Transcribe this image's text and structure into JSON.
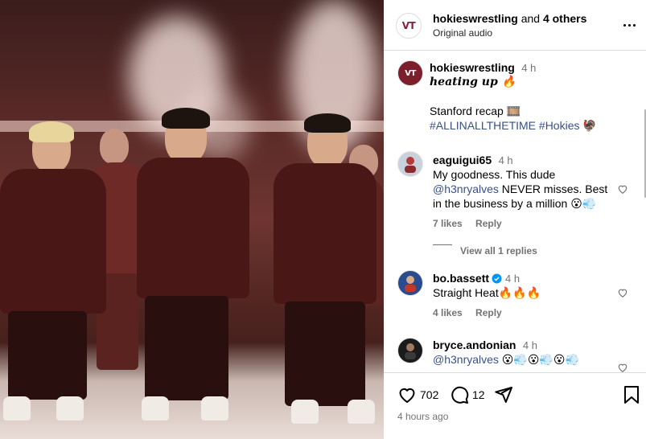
{
  "header": {
    "username": "hokieswrestling",
    "and_text": "and",
    "others": "4 others",
    "audio": "Original audio",
    "avatar_text": "VT"
  },
  "caption": {
    "username": "hokieswrestling",
    "time": "4 h",
    "line1": "heating up 🔥",
    "line2": "Stanford recap 🎞️",
    "hashtag1": "#ALLINALLTHETIME",
    "hashtag2": "#Hokies",
    "emoji_end": "🦃",
    "avatar_text": "VT"
  },
  "comments": [
    {
      "username": "eaguigui65",
      "time": "4 h",
      "text_pre": "My goodness. This dude",
      "mention": "@h3nryalves",
      "text_post": " NEVER misses. Best in the business by a million 😮💨",
      "likes": "7 likes",
      "reply": "Reply",
      "view_replies": "View all 1 replies"
    },
    {
      "username": "bo.bassett",
      "verified": true,
      "time": "4 h",
      "text": "Straight Heat🔥🔥🔥",
      "likes": "4 likes",
      "reply": "Reply"
    },
    {
      "username": "bryce.andonian",
      "time": "4 h",
      "mention": "@h3nryalves",
      "text_post": " 😮💨😮💨😮💨"
    }
  ],
  "actions": {
    "like_count": "702",
    "comment_count": "12",
    "posted": "4 hours ago"
  },
  "colors": {
    "brand": "#861f41",
    "mention": "#385185",
    "muted": "#737373",
    "verified": "#0095f6"
  },
  "icons": [
    "heart-icon",
    "comment-icon",
    "share-icon",
    "bookmark-icon",
    "more-icon",
    "verified-badge-icon"
  ]
}
